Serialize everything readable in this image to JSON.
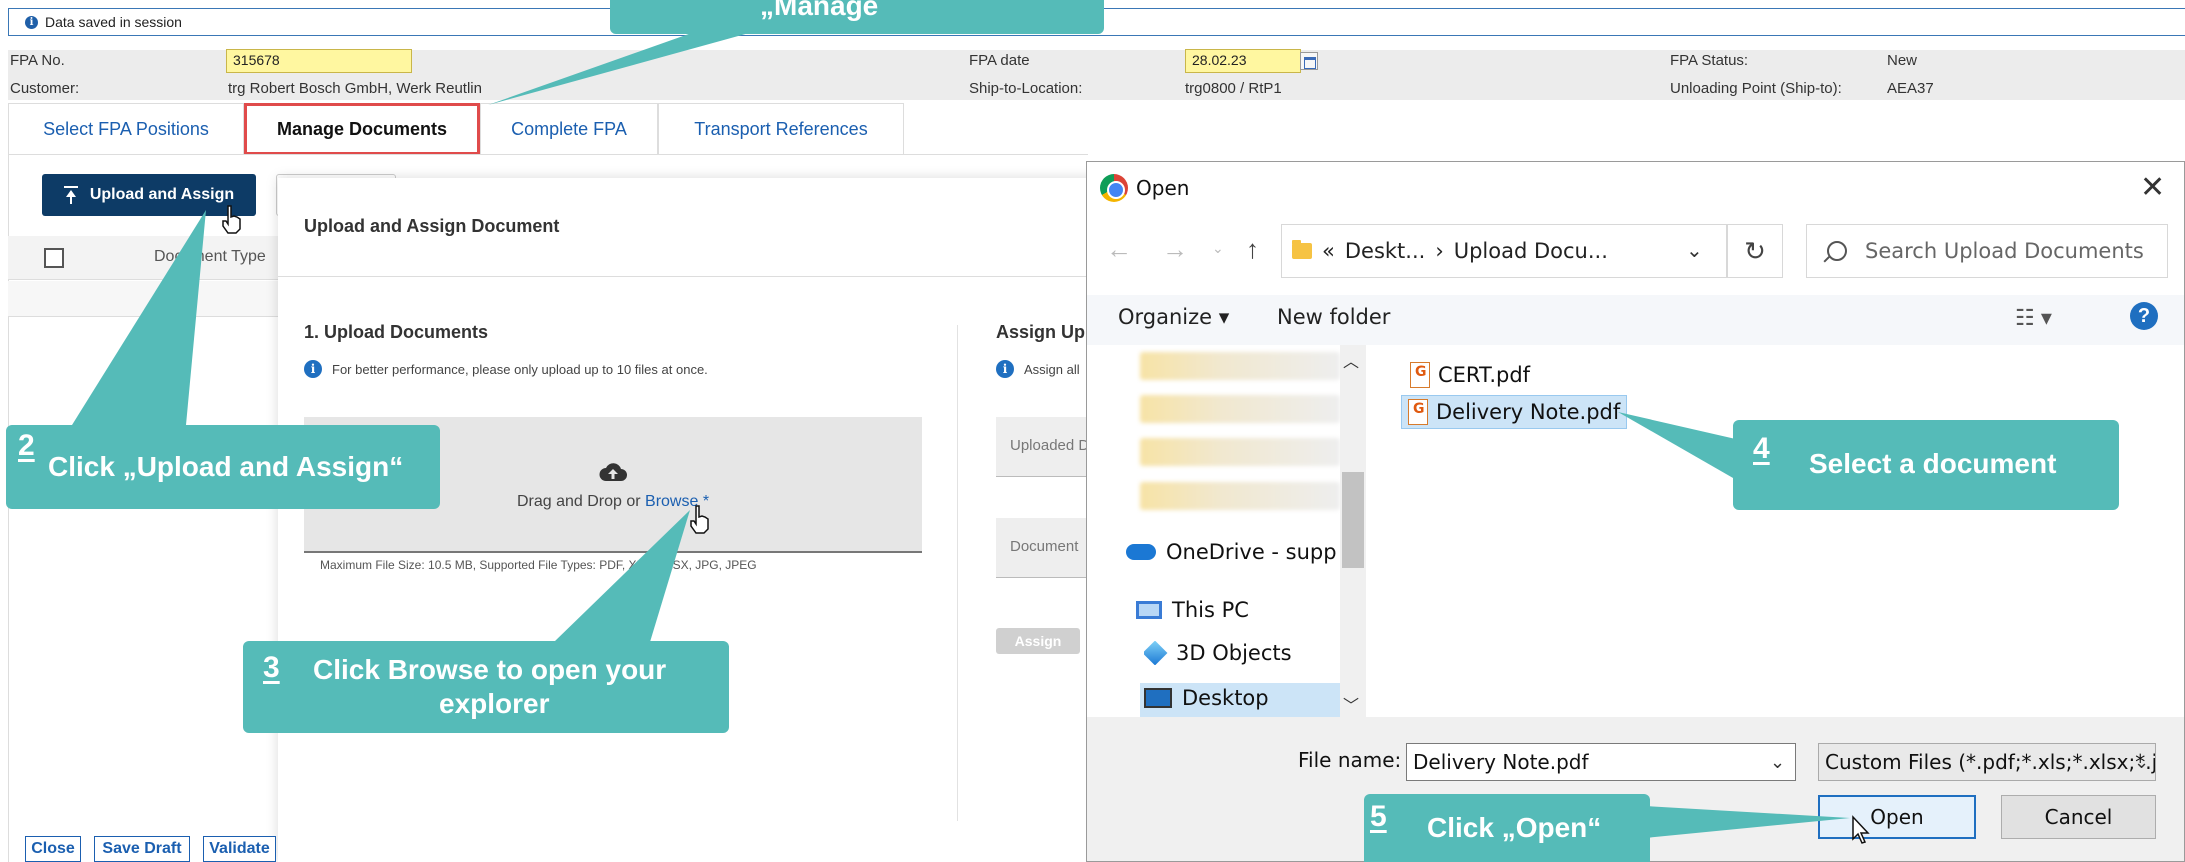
{
  "info_bar": {
    "icon": "info-icon",
    "message": "Data saved in session"
  },
  "header": {
    "fpa_no_label": "FPA No.",
    "fpa_no_value": "315678",
    "customer_label": "Customer:",
    "customer_value": "trg Robert Bosch GmbH, Werk Reutlin",
    "fpa_date_label": "FPA date",
    "fpa_date_value": "28.02.23",
    "ship_to_label": "Ship-to-Location:",
    "ship_to_value": "trg0800 / RtP1",
    "status_label": "FPA Status:",
    "status_value": "New",
    "unloading_label": "Unloading Point (Ship-to):",
    "unloading_value": "AEA37"
  },
  "tabs": [
    {
      "label": "Select FPA Positions",
      "active": false
    },
    {
      "label": "Manage Documents",
      "active": true
    },
    {
      "label": "Complete FPA",
      "active": false
    },
    {
      "label": "Transport References",
      "active": false
    }
  ],
  "documents": {
    "upload_button": "Upload and Assign",
    "column_document_type": "Document Type"
  },
  "modal": {
    "title": "Upload and Assign Document",
    "section1_title": "1. Upload Documents",
    "section1_hint": "For better performance, please only upload up to 10 files at once.",
    "drop_text": "Drag and Drop or ",
    "browse_link": "Browse *",
    "max_size": "Maximum File Size: 10.5 MB, Supported File Types: PDF, XLS, XLSX, JPG, JPEG",
    "section2_title": "Assign Up",
    "section2_hint": "Assign all",
    "uploaded_field": "Uploaded D",
    "doctype_field": "Document",
    "assign_button": "Assign"
  },
  "footer": {
    "close": "Close",
    "save_draft": "Save Draft",
    "validate": "Validate"
  },
  "open_dialog": {
    "title": "Open",
    "address": {
      "prefix": "«",
      "crumb1": "Deskt...",
      "sep": "›",
      "crumb2": "Upload Docu..."
    },
    "search_placeholder": "Search Upload Documents",
    "organize": "Organize ▾",
    "new_folder": "New folder",
    "nav": {
      "onedrive": "OneDrive - supply",
      "this_pc": "This PC",
      "objects3d": "3D Objects",
      "desktop": "Desktop"
    },
    "files": [
      {
        "name": "CERT.pdf",
        "selected": false
      },
      {
        "name": "Delivery Note.pdf",
        "selected": true
      }
    ],
    "file_name_label": "File name:",
    "file_name_value": "Delivery Note.pdf",
    "filter_value": "Custom Files (*.pdf;*.xls;*.xlsx;*.jp",
    "open_button": "Open",
    "cancel_button": "Cancel"
  },
  "callouts": {
    "top_fragment": "„Manage",
    "step2": {
      "num": "2",
      "text": "Click „Upload and Assign“"
    },
    "step3": {
      "num": "3",
      "text_line1": "Click Browse to open your",
      "text_line2": "explorer"
    },
    "step4": {
      "num": "4",
      "text": "Select a document"
    },
    "step5": {
      "num": "5",
      "text": "Click „Open“"
    }
  },
  "colors": {
    "callout": "#55bbb8",
    "primary_button": "#0d3b66",
    "link": "#1b5fb0",
    "active_tab_border": "#e04b4b",
    "highlight_input": "#fff7a0"
  }
}
